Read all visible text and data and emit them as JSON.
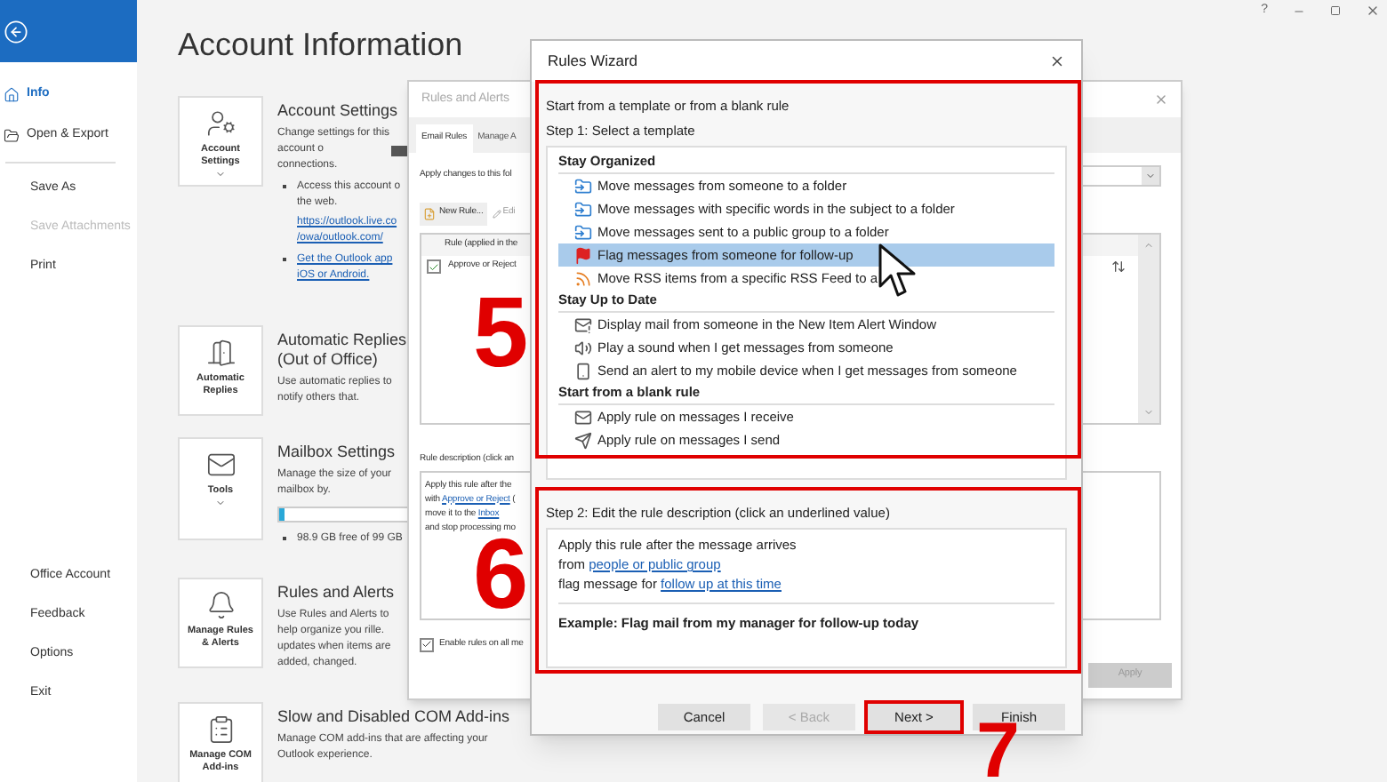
{
  "window_controls": {
    "help": "?"
  },
  "sidebar": {
    "top_items": [
      {
        "label": "Info",
        "kind": "home",
        "selected": true
      },
      {
        "label": "Open & Export",
        "kind": "folder",
        "selected": false
      }
    ],
    "items": [
      {
        "label": "Save As",
        "disabled": false
      },
      {
        "label": "Save Attachments",
        "disabled": true
      },
      {
        "label": "Print",
        "disabled": false
      }
    ],
    "bottom_items": [
      "Office Account",
      "Feedback",
      "Options",
      "Exit"
    ]
  },
  "main": {
    "title": "Account Information",
    "sections": [
      {
        "kind": "account",
        "tile_label": "Account Settings",
        "has_menu": true,
        "title_lines": [
          "Account Settings"
        ],
        "paragraphs": [
          {
            "kind": "text",
            "lines": [
              "Change settings for this",
              "account o"
            ],
            "redacted": true
          },
          {
            "kind": "text",
            "lines": [
              "connections."
            ]
          },
          {
            "kind": "bullet",
            "lines": [
              "Access this account o",
              "the web."
            ]
          },
          {
            "kind": "link",
            "lines": [
              "https://outlook.live.co",
              "/owa/outlook.com/"
            ]
          },
          {
            "kind": "bullet_link",
            "lines": [
              "Get the Outlook app",
              "iOS or Android."
            ]
          }
        ]
      },
      {
        "kind": "auto",
        "tile_label": "Automatic Replies",
        "has_menu": false,
        "title_lines": [
          "Automatic Replies",
          "(Out of Office)"
        ],
        "paragraphs": [
          {
            "kind": "text",
            "lines": [
              "Use automatic replies to",
              "notify others that."
            ]
          }
        ]
      },
      {
        "kind": "tools",
        "tile_label": "Tools",
        "has_menu": true,
        "title_lines": [
          "Mailbox Settings"
        ],
        "paragraphs": [
          {
            "kind": "text",
            "lines": [
              "Manage the size of your",
              "mailbox by."
            ]
          },
          {
            "kind": "meter",
            "level": 0.02
          },
          {
            "kind": "bullet",
            "lines": [
              "98.9 GB free of 99 GB"
            ]
          }
        ]
      },
      {
        "kind": "rules",
        "tile_label": "Manage Rules & Alerts",
        "has_menu": false,
        "title_lines": [
          "Rules and Alerts"
        ],
        "paragraphs": [
          {
            "kind": "text",
            "lines": [
              "Use Rules and Alerts to",
              "help organize you rille.",
              "updates when items are",
              "added, changed."
            ]
          }
        ]
      },
      {
        "kind": "com",
        "tile_label": "Manage COM Add-ins",
        "has_menu": false,
        "title_lines": [
          "Slow and Disabled COM Add-ins"
        ],
        "paragraphs": [
          {
            "kind": "text",
            "lines": [
              "Manage COM add-ins that are affecting your",
              "Outlook experience."
            ]
          }
        ]
      }
    ]
  },
  "rules_and_alerts": {
    "title": "Rules and Alerts",
    "tabs": [
      {
        "label": "Email Rules",
        "selected": true
      },
      {
        "label": "Manage A",
        "selected": false
      }
    ],
    "apply_to_label": "Apply changes to this fol",
    "new_rule_button": "New Rule...",
    "edit_button": "Edi",
    "column_header": "Rule (applied in the",
    "rules": [
      {
        "name": "Approve or Reject",
        "checked": true
      }
    ],
    "description_label": "Rule description (click an",
    "description": [
      [
        {
          "text": "Apply this rule after the"
        }
      ],
      [
        {
          "text": "with "
        },
        {
          "text": "Approve or Reject",
          "link": true
        },
        {
          "text": " ("
        }
      ],
      [
        {
          "text": "move it to the "
        },
        {
          "text": "Inbox",
          "link": true
        }
      ],
      [
        {
          "text": "and stop processing mo"
        }
      ]
    ],
    "enable_all": {
      "label": "Enable rules on all me",
      "checked": true
    },
    "apply_button": {
      "label": "Apply",
      "disabled": true
    }
  },
  "rules_wizard": {
    "title": "Rules Wizard",
    "step1": {
      "intro": "Start from a template or from a blank rule",
      "label": "Step 1: Select a template",
      "highlighted": true
    },
    "groups": [
      {
        "title": "Stay Organized",
        "templates": [
          {
            "label": "Move messages from someone to a folder",
            "kind": "move",
            "selected": false
          },
          {
            "label": "Move messages with specific words in the subject to a folder",
            "kind": "move",
            "selected": false
          },
          {
            "label": "Move messages sent to a public group to a folder",
            "kind": "move",
            "selected": false
          },
          {
            "label": "Flag messages from someone for follow-up",
            "kind": "flag",
            "selected": true
          },
          {
            "label": "Move RSS items from a specific RSS Feed to a",
            "kind": "rss",
            "selected": false
          }
        ]
      },
      {
        "title": "Stay Up to Date",
        "templates": [
          {
            "label": "Display mail from someone in the New Item Alert Window",
            "kind": "alert",
            "selected": false
          },
          {
            "label": "Play a sound when I get messages from someone",
            "kind": "sound",
            "selected": false
          },
          {
            "label": "Send an alert to my mobile device when I get messages from someone",
            "kind": "mobile",
            "selected": false
          }
        ]
      },
      {
        "title": "Start from a blank rule",
        "templates": [
          {
            "label": "Apply rule on messages I receive",
            "kind": "mail",
            "selected": false
          },
          {
            "label": "Apply rule on messages I send",
            "kind": "send",
            "selected": false
          }
        ]
      }
    ],
    "step2": {
      "label": "Step 2: Edit the rule description (click an underlined value)",
      "highlighted": true
    },
    "description": [
      [
        {
          "text": "Apply this rule after the message arrives"
        }
      ],
      [
        {
          "text": "from "
        },
        {
          "text": "people or public group",
          "link": true
        }
      ],
      [
        {
          "text": "flag message for "
        },
        {
          "text": "follow up at this time",
          "link": true
        }
      ]
    ],
    "example": "Example: Flag mail from my manager for follow-up today",
    "buttons": [
      {
        "label": "Cancel",
        "disabled": false,
        "highlighted": false
      },
      {
        "label": "< Back",
        "disabled": true,
        "highlighted": false
      },
      {
        "label": "Next >",
        "disabled": false,
        "highlighted": true
      },
      {
        "label": "Finish",
        "disabled": false,
        "highlighted": false
      }
    ]
  },
  "annotations": [
    {
      "label": "5"
    },
    {
      "label": "6"
    },
    {
      "label": "7"
    }
  ]
}
